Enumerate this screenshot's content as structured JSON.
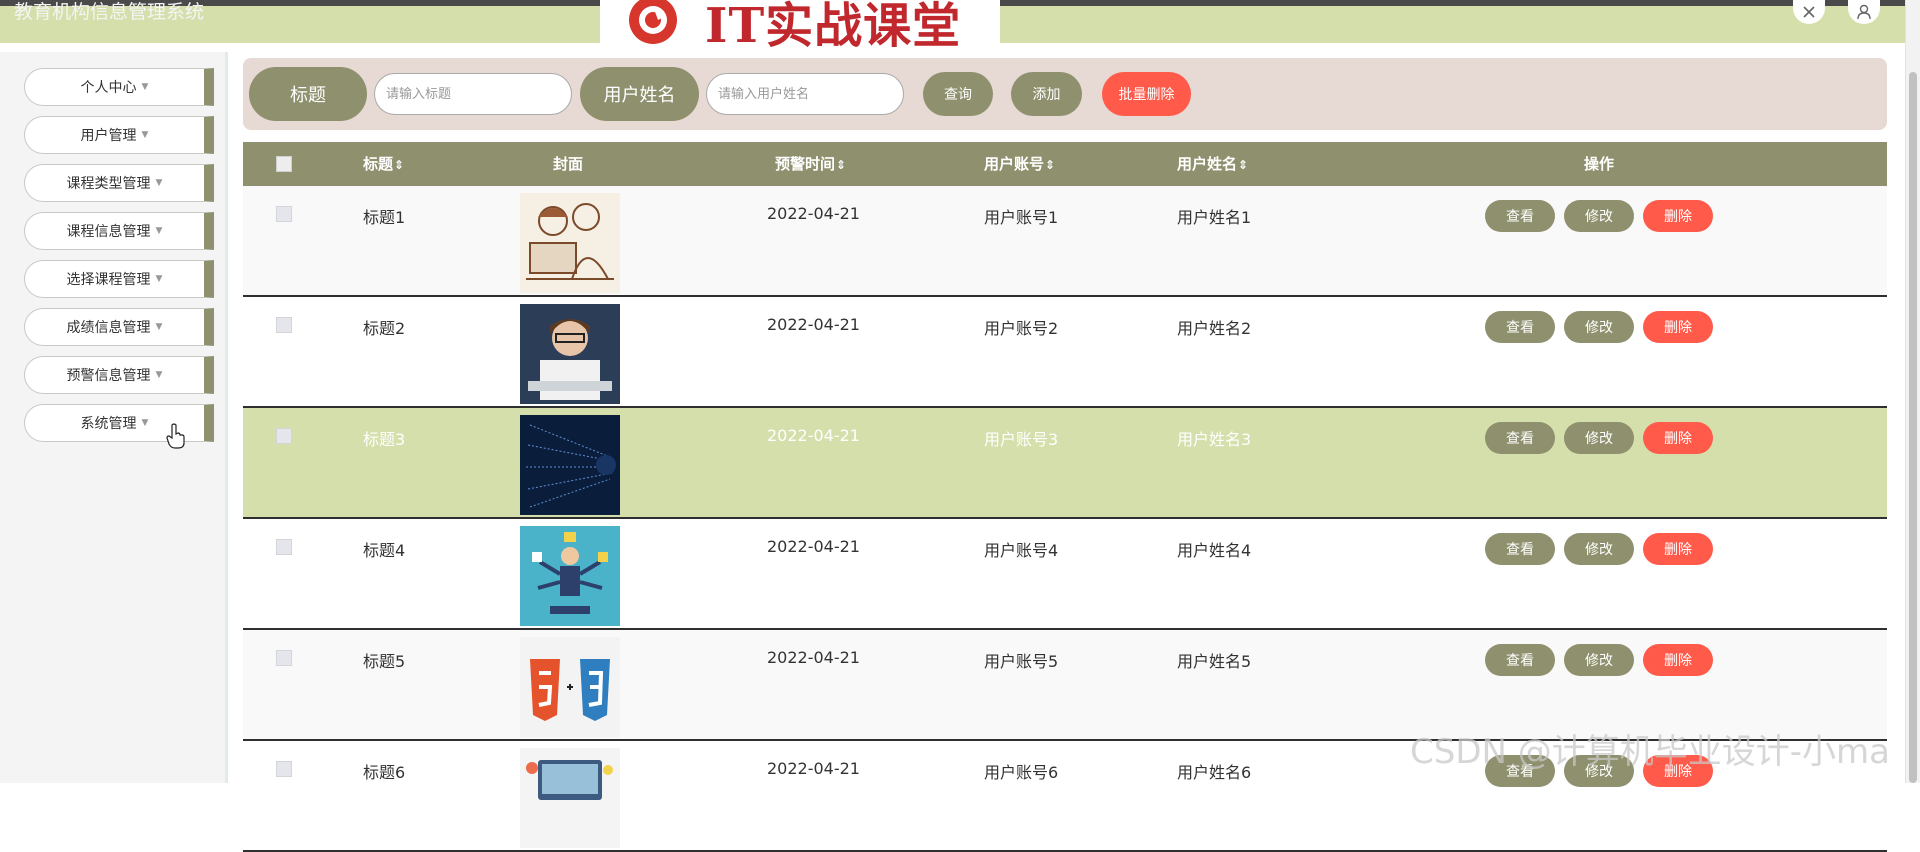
{
  "app": {
    "title": "教育机构信息管理系统",
    "logo_text": "IT实战课堂"
  },
  "header_icons": [
    "close-icon",
    "user-icon"
  ],
  "sidebar": {
    "items": [
      {
        "label": "个人中心"
      },
      {
        "label": "用户管理"
      },
      {
        "label": "课程类型管理"
      },
      {
        "label": "课程信息管理"
      },
      {
        "label": "选择课程管理"
      },
      {
        "label": "成绩信息管理"
      },
      {
        "label": "预警信息管理"
      },
      {
        "label": "系统管理"
      }
    ]
  },
  "search": {
    "title_label": "标题",
    "title_placeholder": "请输入标题",
    "username_label": "用户姓名",
    "username_placeholder": "请输入用户姓名",
    "query_button": "查询",
    "add_button": "添加",
    "batch_delete_button": "批量删除"
  },
  "table": {
    "columns": {
      "title": "标题",
      "cover": "封面",
      "warning_time": "预警时间",
      "account": "用户账号",
      "name": "用户姓名",
      "actions": "操作"
    },
    "rows": [
      {
        "title": "标题1",
        "cover": "sketch-coder-image",
        "time": "2022-04-21",
        "account": "用户账号1",
        "name": "用户姓名1"
      },
      {
        "title": "标题2",
        "cover": "girl-keyboard-image",
        "time": "2022-04-21",
        "account": "用户账号2",
        "name": "用户姓名2"
      },
      {
        "title": "标题3",
        "cover": "code-tunnel-image",
        "time": "2022-04-21",
        "account": "用户账号3",
        "name": "用户姓名3"
      },
      {
        "title": "标题4",
        "cover": "multitask-person-image",
        "time": "2022-04-21",
        "account": "用户账号4",
        "name": "用户姓名4"
      },
      {
        "title": "标题5",
        "cover": "html5-css3-image",
        "time": "2022-04-21",
        "account": "用户账号5",
        "name": "用户姓名5"
      },
      {
        "title": "标题6",
        "cover": "devices-image",
        "time": "2022-04-21",
        "account": "用户账号6",
        "name": "用户姓名6"
      }
    ],
    "row_actions": {
      "view": "查看",
      "edit": "修改",
      "delete": "删除"
    }
  },
  "colors": {
    "accent": "#8e906e",
    "header_bar": "#d4dfab",
    "danger": "#ff5a4a",
    "search_panel": "#e7d9d3"
  },
  "watermark": "CSDN @计算机毕业设计-小ma"
}
